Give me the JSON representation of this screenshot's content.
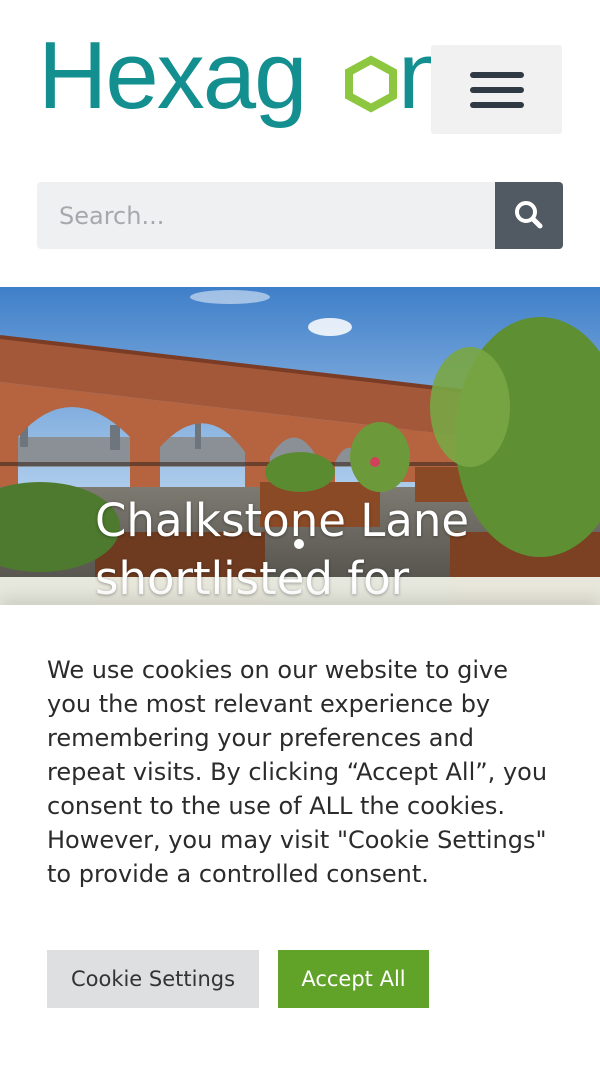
{
  "header": {
    "logo_text": "Hexagon",
    "menu_icon": "hamburger-menu-icon"
  },
  "search": {
    "placeholder": "Search...",
    "button_icon": "search-icon"
  },
  "hero": {
    "title": "Chalkstone Lane shortlisted for"
  },
  "cookie_banner": {
    "message": "We use cookies on our website to give you the most relevant experience by remembering your preferences and repeat visits. By clicking “Accept All”, you consent to the use of ALL the cookies. However, you may visit \"Cookie Settings\" to provide a controlled consent.",
    "settings_label": "Cookie Settings",
    "accept_label": "Accept All"
  },
  "colors": {
    "brand_teal": "#138f8f",
    "brand_green": "#8dc63f",
    "accept_green": "#61a229",
    "search_button": "#515962"
  }
}
